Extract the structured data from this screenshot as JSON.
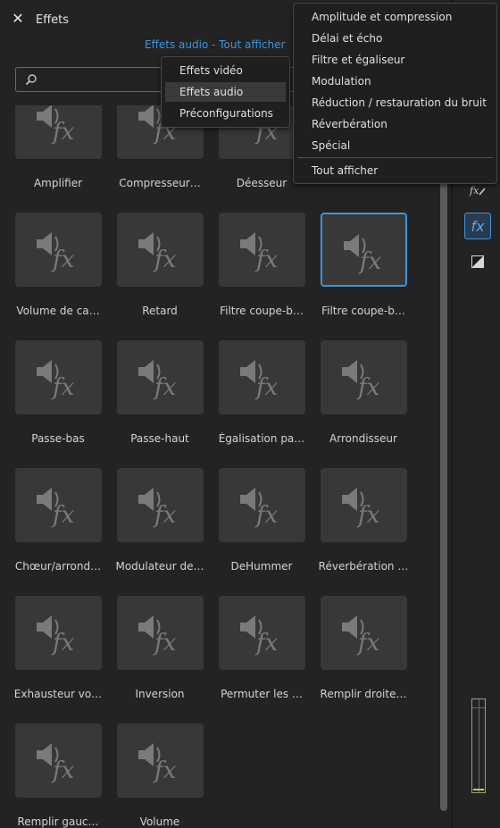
{
  "window": {
    "title": "Effets",
    "close_glyph": "✕"
  },
  "filter_link": "Effets audio - Tout afficher",
  "search": {
    "placeholder": ""
  },
  "type_menu": {
    "items": [
      "Effets vidéo",
      "Effets audio",
      "Préconfigurations"
    ],
    "selected": "Effets audio"
  },
  "category_menu": {
    "items": [
      "Amplitude et compression",
      "Délai et écho",
      "Filtre et égaliseur",
      "Modulation",
      "Réduction / restauration du bruit",
      "Réverbération",
      "Spécial"
    ],
    "footer": "Tout afficher"
  },
  "effects": [
    "Amplifier",
    "Compresseur…",
    "Déesseur",
    "",
    "Volume de ca…",
    "Retard",
    "Filtre coupe-b…",
    "Filtre coupe-b…",
    "Passe-bas",
    "Passe-haut",
    "Égalisation pa…",
    "Arrondisseur",
    "Chœur/arrond…",
    "Modulateur de…",
    "DeHummer",
    "Réverbération …",
    "Exhausteur vo…",
    "Inversion",
    "Permuter les …",
    "Remplir droite…",
    "Remplir gauc…",
    "Volume"
  ],
  "selected_effect_index": 7,
  "right_panel": {
    "icons": [
      "fx-edit-icon",
      "fx-icon",
      "color-correction-icon"
    ],
    "fx_label": "fx"
  },
  "colors": {
    "accent": "#3d95e0",
    "panel_bg": "#232323",
    "tile_bg": "#383838"
  }
}
